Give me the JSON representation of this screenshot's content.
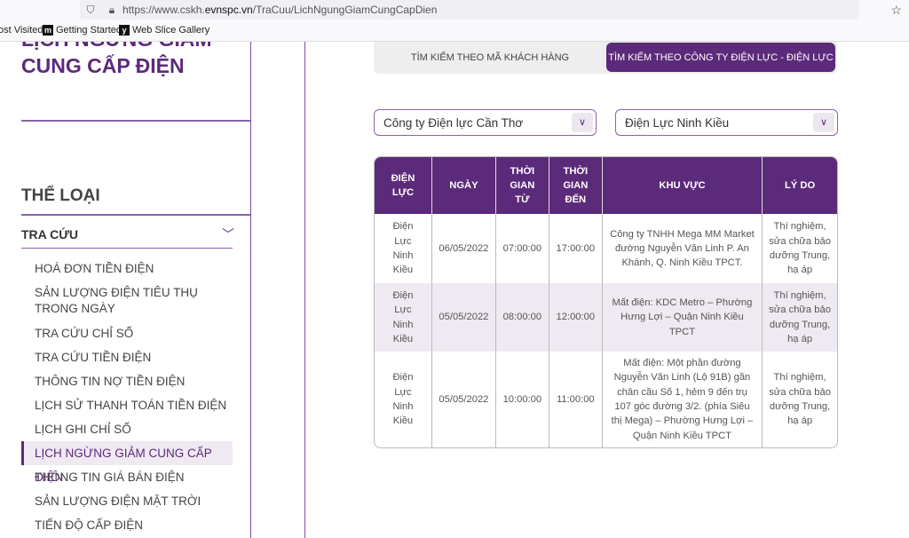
{
  "browser": {
    "url_prefix": "https://www.cskh.",
    "url_host": "evnspc.vn",
    "url_path": "/TraCuu/LichNgungGiamCungCapDien",
    "bookmarks": [
      "ost Visited",
      "Getting Started",
      "Web Slice Gallery"
    ]
  },
  "page": {
    "title_line1": "LỊCH NGỪNG GIẢM",
    "title_line2": "CUNG CẤP ĐIỆN"
  },
  "sidebar": {
    "category": "THỂ LOẠI",
    "section": "TRA CỨU",
    "items": [
      "HOÁ ĐƠN TIỀN ĐIỆN",
      "SẢN LƯỢNG ĐIỆN TIÊU THỤ TRONG NGÀY",
      "TRA CỨU CHỈ SỐ",
      "TRA CỨU TIỀN ĐIỆN",
      "THÔNG TIN NỢ TIỀN ĐIỆN",
      "LỊCH SỬ THANH TOÁN TIỀN ĐIỆN",
      "LỊCH GHI CHỈ SỐ",
      "LỊCH NGỪNG GIẢM CUNG CẤP ĐIỆN",
      "THÔNG TIN GIÁ BÁN ĐIỆN",
      "SẢN LƯỢNG ĐIỆN MẶT TRỜI",
      "TIẾN ĐỘ CẤP ĐIỆN"
    ],
    "active_index": 7
  },
  "tabs": [
    "TÌM KIẾM THEO MÃ KHÁCH HÀNG",
    "TÌM KIẾM THEO CÔNG TY ĐIỆN LỰC - ĐIỆN LỰC"
  ],
  "filters": {
    "company": "Công ty Điện lực Cần Thơ",
    "unit": "Điện Lực Ninh Kiều"
  },
  "table": {
    "headers": [
      "ĐIỆN LỰC",
      "NGÀY",
      "THỜI GIAN TỪ",
      "THỜI GIAN ĐẾN",
      "KHU VỰC",
      "LÝ DO"
    ],
    "rows": [
      [
        "Điện Lực Ninh Kiều",
        "06/05/2022",
        "07:00:00",
        "17:00:00",
        "Công ty TNHH Mega MM Market đường Nguyễn Văn Linh P. An Khánh, Q. Ninh Kiều TPCT.",
        "Thí nghiệm, sửa chữa bảo dưỡng Trung, hạ áp"
      ],
      [
        "Điện Lực Ninh Kiều",
        "05/05/2022",
        "08:00:00",
        "12:00:00",
        "Mất điện: KDC Metro – Phường Hưng Lợi – Quận Ninh Kiều TPCT",
        "Thí nghiệm, sửa chữa bảo dưỡng Trung, hạ áp"
      ],
      [
        "Điện Lực Ninh Kiều",
        "05/05/2022",
        "10:00:00",
        "11:00:00",
        "Mất điện: Một phần đường Nguyễn Văn Linh (Lộ 91B) gần chân cầu Số 1, hẻm 9 đến trụ 107 góc đường 3/2. (phía Siêu thị Mega) – Phường Hưng Lợi – Quận Ninh Kiều TPCT",
        "Thí nghiệm, sửa chữa bảo dưỡng Trung, hạ áp"
      ]
    ]
  }
}
